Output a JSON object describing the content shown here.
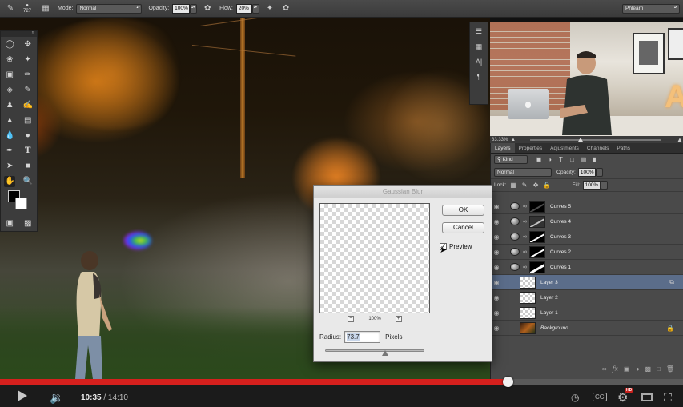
{
  "options_bar": {
    "brush_size": "727",
    "mode_label": "Mode:",
    "mode_value": "Normal",
    "opacity_label": "Opacity:",
    "opacity_value": "100%",
    "flow_label": "Flow:",
    "flow_value": "20%",
    "workspace": "Phlearn"
  },
  "video_panel": {
    "zoom": "33.33%"
  },
  "layers_panel": {
    "tabs": [
      "Layers",
      "Properties",
      "Adjustments",
      "Channels",
      "Paths"
    ],
    "filter_kind": "Kind",
    "blend_mode": "Normal",
    "opacity_label": "Opacity:",
    "opacity_value": "100%",
    "lock_label": "Lock:",
    "fill_label": "Fill:",
    "fill_value": "100%",
    "layers": [
      {
        "name": "Curves 5",
        "type": "adjustment",
        "selected": false
      },
      {
        "name": "Curves 4",
        "type": "adjustment",
        "selected": false
      },
      {
        "name": "Curves 3",
        "type": "adjustment",
        "selected": false
      },
      {
        "name": "Curves 2",
        "type": "adjustment",
        "selected": false
      },
      {
        "name": "Curves 1",
        "type": "adjustment",
        "selected": false
      },
      {
        "name": "Layer 3",
        "type": "pixel",
        "selected": true
      },
      {
        "name": "Layer 2",
        "type": "pixel",
        "selected": false
      },
      {
        "name": "Layer 1",
        "type": "pixel",
        "selected": false
      },
      {
        "name": "Background",
        "type": "background",
        "selected": false
      }
    ]
  },
  "dialog": {
    "title": "Gaussian Blur",
    "ok_label": "OK",
    "cancel_label": "Cancel",
    "preview_label": "Preview",
    "preview_checked": true,
    "zoom": "100%",
    "radius_label": "Radius:",
    "radius_value": "73.7",
    "radius_unit": "Pixels"
  },
  "player": {
    "current_time": "10:35",
    "duration": "/ 14:10",
    "progress": 0.743,
    "hd_badge": "HD",
    "cc_label": "CC"
  },
  "colors": {
    "accent_red": "#d5201d",
    "selected_layer": "#5b6d8a"
  }
}
